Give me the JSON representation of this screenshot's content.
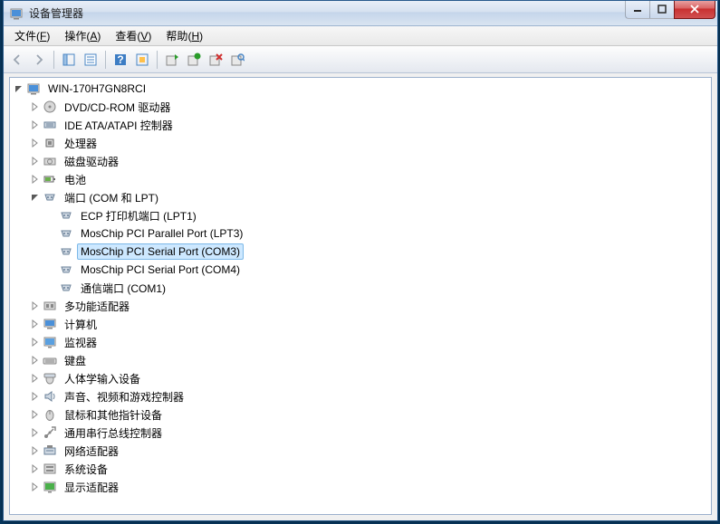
{
  "window": {
    "title": "设备管理器"
  },
  "menu": {
    "file": "文件",
    "file_u": "F",
    "action": "操作",
    "action_u": "A",
    "view": "查看",
    "view_u": "V",
    "help": "帮助",
    "help_u": "H"
  },
  "tree": {
    "root": "WIN-170H7GN8RCI",
    "items": [
      {
        "label": "DVD/CD-ROM 驱动器",
        "icon": "disc",
        "expanded": false
      },
      {
        "label": "IDE ATA/ATAPI 控制器",
        "icon": "ide",
        "expanded": false
      },
      {
        "label": "处理器",
        "icon": "cpu",
        "expanded": false
      },
      {
        "label": "磁盘驱动器",
        "icon": "disk",
        "expanded": false
      },
      {
        "label": "电池",
        "icon": "battery",
        "expanded": false
      },
      {
        "label": "端口 (COM 和 LPT)",
        "icon": "port",
        "expanded": true,
        "children": [
          {
            "label": "ECP 打印机端口 (LPT1)",
            "icon": "port"
          },
          {
            "label": "MosChip PCI Parallel Port (LPT3)",
            "icon": "port"
          },
          {
            "label": "MosChip PCI Serial Port (COM3)",
            "icon": "port",
            "selected": true
          },
          {
            "label": "MosChip PCI Serial Port (COM4)",
            "icon": "port"
          },
          {
            "label": "通信端口 (COM1)",
            "icon": "port"
          }
        ]
      },
      {
        "label": "多功能适配器",
        "icon": "adapter",
        "expanded": false
      },
      {
        "label": "计算机",
        "icon": "computer",
        "expanded": false
      },
      {
        "label": "监视器",
        "icon": "monitor",
        "expanded": false
      },
      {
        "label": "键盘",
        "icon": "keyboard",
        "expanded": false
      },
      {
        "label": "人体学输入设备",
        "icon": "hid",
        "expanded": false
      },
      {
        "label": "声音、视频和游戏控制器",
        "icon": "sound",
        "expanded": false
      },
      {
        "label": "鼠标和其他指针设备",
        "icon": "mouse",
        "expanded": false
      },
      {
        "label": "通用串行总线控制器",
        "icon": "usb",
        "expanded": false
      },
      {
        "label": "网络适配器",
        "icon": "network",
        "expanded": false
      },
      {
        "label": "系统设备",
        "icon": "system",
        "expanded": false
      },
      {
        "label": "显示适配器",
        "icon": "display",
        "expanded": false
      }
    ]
  }
}
